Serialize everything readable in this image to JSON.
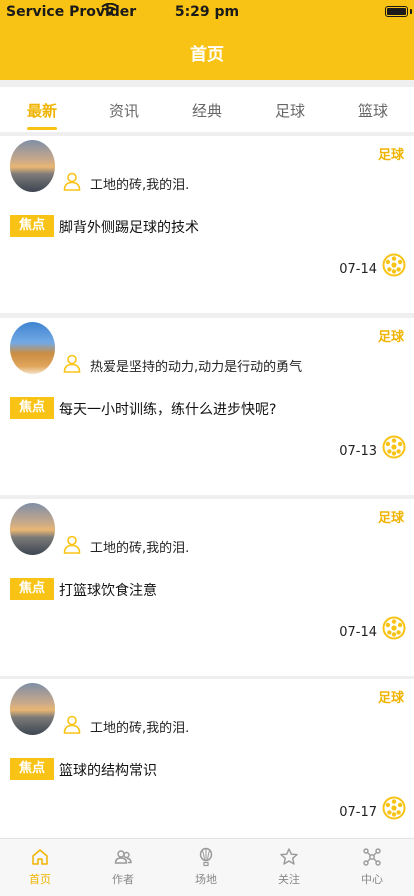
{
  "status_bar": {
    "carrier": "Service Provider",
    "time": "5:29 pm"
  },
  "nav": {
    "title": "首页"
  },
  "tabs": [
    {
      "label": "最新",
      "active": true
    },
    {
      "label": "资讯"
    },
    {
      "label": "经典"
    },
    {
      "label": "足球"
    },
    {
      "label": "篮球"
    }
  ],
  "posts": [
    {
      "avatar": "sunset-avatar",
      "author": "工地的砖,我的泪.",
      "category": "足球",
      "tag": "焦点",
      "title": "脚背外侧踢足球的技术",
      "date": "07-14",
      "icon": "football-icon"
    },
    {
      "avatar": "doge-avatar",
      "author": "热爱是坚持的动力,动力是行动的勇气",
      "category": "足球",
      "tag": "焦点",
      "title": "每天一小时训练，练什么进步快呢?",
      "date": "07-13",
      "icon": "football-icon"
    },
    {
      "avatar": "sunset-avatar",
      "author": "工地的砖,我的泪.",
      "category": "足球",
      "tag": "焦点",
      "title": "打篮球饮食注意",
      "date": "07-14",
      "icon": "football-icon"
    },
    {
      "avatar": "sunset-avatar",
      "author": "工地的砖,我的泪.",
      "category": "足球",
      "tag": "焦点",
      "title": "篮球的结构常识",
      "date": "07-17",
      "icon": "football-icon"
    }
  ],
  "tabbar": [
    {
      "label": "首页",
      "icon": "home-icon",
      "active": true
    },
    {
      "label": "作者",
      "icon": "users-icon"
    },
    {
      "label": "场地",
      "icon": "balloon-icon"
    },
    {
      "label": "关注",
      "icon": "star-icon"
    },
    {
      "label": "中心",
      "icon": "network-icon"
    }
  ],
  "colors": {
    "accent": "#f8c315",
    "accent_text": "#f0b400"
  }
}
